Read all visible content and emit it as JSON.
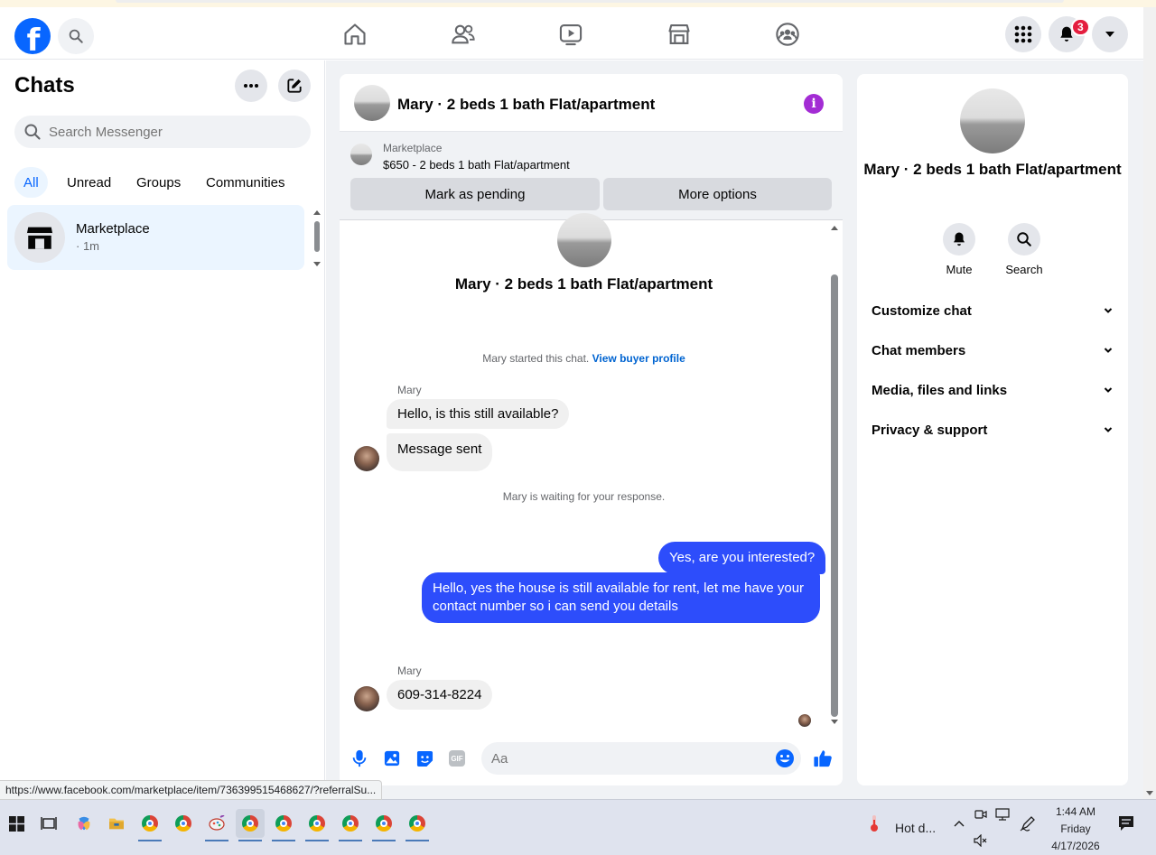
{
  "header": {
    "logo_letter": "f",
    "notification_count": "3"
  },
  "sidebar": {
    "title": "Chats",
    "search_placeholder": "Search Messenger",
    "filters": [
      "All",
      "Unread",
      "Groups",
      "Communities"
    ],
    "active_filter": "All",
    "chats": [
      {
        "name": "Marketplace",
        "time": "· 1m"
      }
    ]
  },
  "status_url": "https://www.facebook.com/marketplace/item/736399515468627/?referralSu...",
  "conversation": {
    "title": "Mary · 2 beds 1 bath Flat/apartment",
    "marketplace_label": "Marketplace",
    "listing": "$650 - 2 beds 1 bath Flat/apartment",
    "mark_pending_label": "Mark as pending",
    "more_options_label": "More options",
    "center_name": "Mary · 2 beds 1 bath Flat/apartment",
    "started_text": "Mary started this chat.",
    "view_profile_label": "View buyer profile",
    "waiting_text": "Mary is waiting for your response.",
    "sender_name": "Mary",
    "incoming_1": "Hello, is this still available?",
    "incoming_2": "Message sent",
    "outgoing_1": "Yes, are you interested?",
    "outgoing_2": "Hello, yes the house is still available for rent, let me have your contact number so i can send you details",
    "incoming_3": "609-314-8224",
    "composer_placeholder": "Aa",
    "gif_label": "GIF"
  },
  "details": {
    "name": "Mary · 2 beds 1 bath Flat/apartment",
    "mute_label": "Mute",
    "search_label": "Search",
    "sections": [
      "Customize chat",
      "Chat members",
      "Media, files and links",
      "Privacy & support"
    ]
  },
  "taskbar": {
    "weather_text": "Hot d...",
    "time": "1:44 AM",
    "day": "Friday",
    "date": "4/17/2026"
  },
  "colors": {
    "brand": "#0866ff",
    "outgoing_bubble": "#2d4dfb",
    "info_icon": "#a32cd4",
    "badge": "#e41e3f"
  }
}
